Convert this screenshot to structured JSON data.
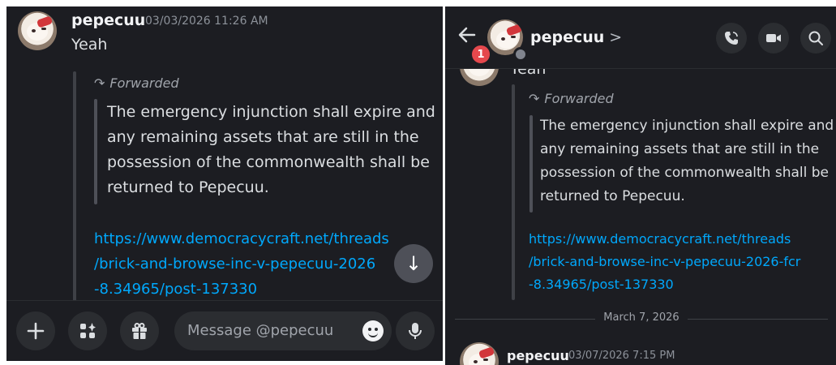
{
  "left": {
    "message": {
      "username": "pepecuu",
      "timestamp": "03/03/2026 11:26 AM",
      "text": "Yeah"
    },
    "forward": {
      "label": "Forwarded",
      "quote_lines": [
        "The emergency injunction shall expire and",
        "any remaining assets that are still in the",
        "possession of the commonwealth shall be",
        "returned to Pepecuu."
      ],
      "link_lines": [
        "https://www.democracycraft.net/threads",
        "/brick-and-browse-inc-v-pepecuu-2026",
        "-8.34965/post-137330"
      ]
    },
    "composer": {
      "placeholder": "Message @pepecuu"
    }
  },
  "right": {
    "header": {
      "name": "pepecuu",
      "chevron": ">",
      "badge": "1"
    },
    "partial_text": "Yeah",
    "forward": {
      "label": "Forwarded",
      "quote_lines": [
        "The emergency injunction shall expire and",
        "any remaining assets that are still in the",
        "possession of the commonwealth shall be",
        "returned to Pepecuu."
      ],
      "link_lines": [
        "https://www.democracycraft.net/threads",
        "/brick-and-browse-inc-v-pepecuu-2026-fcr",
        "-8.34965/post-137330"
      ]
    },
    "date_divider": "March 7, 2026",
    "next_message": {
      "username": "pepecuu",
      "timestamp": "03/07/2026 7:15 PM"
    }
  },
  "icons": {
    "plus": "plus-icon",
    "apps": "apps-icon",
    "gift": "gift-icon",
    "emoji": "emoji-icon",
    "mic": "mic-icon",
    "scroll_down": "arrow-down-icon",
    "back": "arrow-left-icon",
    "call": "phone-call-icon",
    "video": "video-camera-icon",
    "search": "search-icon"
  },
  "colors": {
    "background": "#1c1d22",
    "link": "#00a8fc",
    "badge": "#e5484d"
  }
}
